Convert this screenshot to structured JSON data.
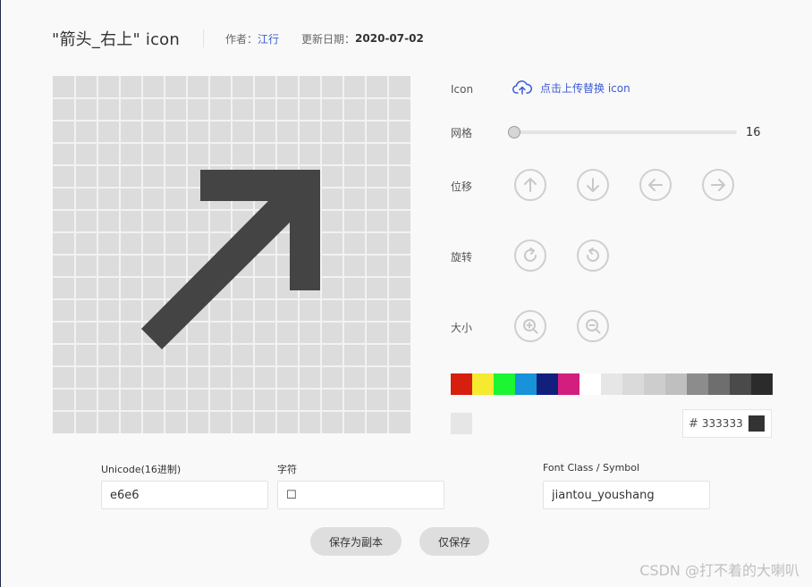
{
  "header": {
    "title": "\"箭头_右上\"  icon",
    "author_label": "作者：",
    "author": "江行",
    "date_label": "更新日期：",
    "date": "2020-07-02"
  },
  "controls": {
    "icon_label": "Icon",
    "upload_text": "点击上传替换 icon",
    "grid_label": "网格",
    "grid_value": "16",
    "move_label": "位移",
    "rotate_label": "旋转",
    "size_label": "大小",
    "move_icons": [
      "arrow-up-icon",
      "arrow-down-icon",
      "arrow-left-icon",
      "arrow-right-icon"
    ],
    "rotate_icons": [
      "rotate-cw-icon",
      "rotate-ccw-icon"
    ],
    "zoom_icons": [
      "zoom-in-icon",
      "zoom-out-icon"
    ]
  },
  "palette": [
    "#d71f0f",
    "#f5ea30",
    "#1bf532",
    "#1892d8",
    "#11207d",
    "#d21e7c",
    "#ffffff",
    "#e6e6e6",
    "#dadada",
    "#cdcdcd",
    "#bfbfbf",
    "#8c8c8c",
    "#6e6e6e",
    "#4a4a4a",
    "#2b2b2b"
  ],
  "background_swatch": "#e6e6e6",
  "color": {
    "hash": "#",
    "value": "333333",
    "chip": "#333333"
  },
  "fields": {
    "unicode_label": "Unicode(16进制)",
    "unicode_value": "e6e6",
    "char_label": "字符",
    "char_value": "☐",
    "font_class_label": "Font Class / Symbol",
    "font_class_value": "jiantou_youshang"
  },
  "buttons": {
    "save_copy": "保存为副本",
    "save_only": "仅保存"
  },
  "watermark": "CSDN @打不着的大喇叭",
  "icon_color": "#444444"
}
